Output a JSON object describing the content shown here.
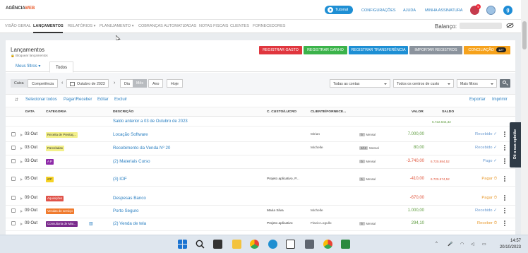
{
  "header": {
    "logo_main": "AGÊNCIA",
    "logo_accent": "WEB",
    "logo_sub": "",
    "tutorial_label": "Tutorial",
    "links": [
      "CONFIGURAÇÕES",
      "AJUDA",
      "MINHA ASSINATURA"
    ],
    "notification_count": "9",
    "avatar_letter": "g"
  },
  "nav": {
    "items": [
      "VISÃO GERAL",
      "LANÇAMENTOS",
      "RELATÓRIOS ▾",
      "PLANEJAMENTO ▾",
      "COBRANÇAS AUTOMATIZADAS",
      "NOTAS FISCAIS",
      "CLIENTES",
      "FORNECEDORES"
    ],
    "balance_label": "Balanço:"
  },
  "page": {
    "title": "Lançamentos",
    "subtitle": "🔒 Bloquear lançamentos"
  },
  "actions": {
    "gasto": "REGISTRAR GASTO",
    "ganho": "REGISTRAR GANHO",
    "transferencia": "REGISTRAR TRANSFERÊNCIA",
    "importar": "IMPORTAR REGISTROS",
    "conciliacao": "CONCILIAÇÃO",
    "conciliacao_count": "127"
  },
  "tabs": {
    "filters": "Meus filtros ▾",
    "all": "Todos"
  },
  "filters": {
    "caixa": "Caixa",
    "competencia": "Competência",
    "period": "Outubro de 2023",
    "dia": "Dia",
    "mes": "Mês",
    "ano": "Ano",
    "hoje": "Hoje",
    "contas": "Todas as contas",
    "centros": "Todos os centros de custo",
    "mais": "Mais filtros"
  },
  "toolbar": {
    "select_all": "Selecionar todos",
    "pay": "Pagar/Receber",
    "edit": "Editar",
    "delete": "Excluir",
    "export": "Exportar",
    "print": "Imprimir"
  },
  "columns": [
    "DATA",
    "CATEGORIA",
    "DESCRIÇÃO",
    "C. CUSTO/LUCRO",
    "CLIENTE/FORNECE...",
    "VALOR",
    "SALDO"
  ],
  "saldo_anterior": {
    "label": "Saldo anterior a 03 de Outubro de 2023",
    "value": "6.722.644,32"
  },
  "rows": [
    {
      "date": "03 Out",
      "category": "Receita de Prestaç...",
      "cat_color": "#f3f08a",
      "cat_text": "#333",
      "desc": "Locação Software",
      "cc": "",
      "client": "Mirian",
      "freq_tag": "↻",
      "freq": "Mensal",
      "value": "7.000,00",
      "vclass": "green",
      "balance": "",
      "status": "Recebido ✓",
      "sclass": "blue"
    },
    {
      "date": "03 Out",
      "category": "Parceladas",
      "cat_color": "#f3f08a",
      "cat_text": "#333",
      "desc": "Recebimento da Venda Nº 20",
      "cc": "",
      "client": "Michelle",
      "freq_tag": "2/10",
      "freq": "Mensal",
      "value": "80,00",
      "vclass": "green",
      "balance": "",
      "status": "Recebido ✓",
      "sclass": "blue"
    },
    {
      "date": "03 Out",
      "category": "A  P",
      "cat_color": "#8e2aa8",
      "cat_text": "#fff",
      "desc": "(2) Materiais Curso",
      "cc": "",
      "client": "",
      "freq_tag": "↻",
      "freq": "Mensal",
      "value": "-3.740,00",
      "vclass": "red",
      "balance": "6.725.984,52",
      "status": "Pago ✓",
      "sclass": "blue"
    },
    {
      "date": "05 Out",
      "category": "iCF",
      "cat_color": "#f6d326",
      "cat_text": "#333",
      "desc": "(3) IOF",
      "cc": "Projeto aplicativo, P...",
      "client": "",
      "freq_tag": "↻",
      "freq": "Mensal",
      "value": "-410,00",
      "vclass": "red",
      "balance": "6.725.574,52",
      "status": "Pagar ⏱",
      "sclass": "orange"
    },
    {
      "date": "09 Out",
      "category": "Aquisições",
      "cat_color": "#e0534a",
      "cat_text": "#fff",
      "desc": "Despesas Banco",
      "cc": "",
      "client": "",
      "freq_tag": "",
      "freq": "",
      "value": "-670,00",
      "vclass": "red",
      "balance": "",
      "status": "Pagar ⏱",
      "sclass": "orange"
    },
    {
      "date": "09 Out",
      "category": "Vendas de serviço",
      "cat_color": "#f07b2e",
      "cat_text": "#fff",
      "desc": "Porto Seguro",
      "cc": "Maria Silva",
      "client": "Michelle",
      "freq_tag": "",
      "freq": "",
      "value": "1.000,00",
      "vclass": "green",
      "balance": "",
      "status": "Recebido ✓",
      "sclass": "blue"
    },
    {
      "date": "09 Out",
      "category": "Consultoria de Mar...",
      "cat_color": "#7a2a8c",
      "cat_text": "#fff",
      "desc": "(2) Venda de tela",
      "cc": "Projeto aplicativo",
      "client": "Flavio Logullo",
      "freq_tag": "↻",
      "freq": "Mensal",
      "value": "294,10",
      "vclass": "green",
      "balance": "",
      "status": "Receber ⏱",
      "sclass": "orange"
    }
  ],
  "feedback": "Dê a sua opinião",
  "clock": {
    "time": "14:57",
    "date": "20/10/2023"
  }
}
